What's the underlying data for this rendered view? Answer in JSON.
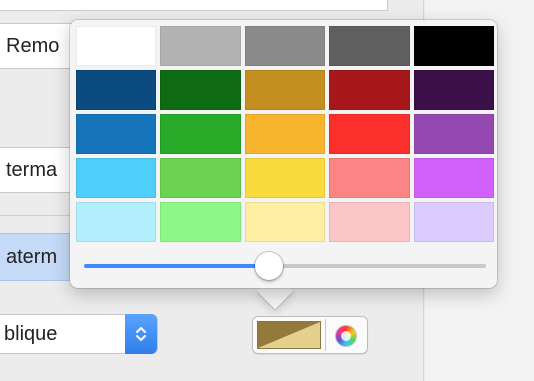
{
  "background_panel": {
    "field_remove": "Remo",
    "field_terma": "terma",
    "field_selected": "aterm",
    "popup_value": "blique",
    "popup_arrows_icon": "chevron-up-down-icon"
  },
  "color_well": {
    "current_color_top": "#947a3a",
    "current_color_bottom": "#e4cf8c",
    "color_wheel_icon": "color-wheel-icon"
  },
  "color_popover": {
    "swatches": [
      [
        "#ffffff",
        "#b3b3b3",
        "#8a8a8a",
        "#5f5f5f",
        "#000000"
      ],
      [
        "#0c4b7f",
        "#0e6b14",
        "#c48f21",
        "#a7181d",
        "#3b0f48"
      ],
      [
        "#1675ba",
        "#29ab29",
        "#f7b52e",
        "#fb2f2b",
        "#9348b2"
      ],
      [
        "#4ecffa",
        "#6cd251",
        "#f9db3e",
        "#fb8584",
        "#d161fb"
      ],
      [
        "#b2effd",
        "#8ef886",
        "#feefa3",
        "#fcc5c7",
        "#dccbfd"
      ]
    ],
    "brightness": 0.46
  }
}
